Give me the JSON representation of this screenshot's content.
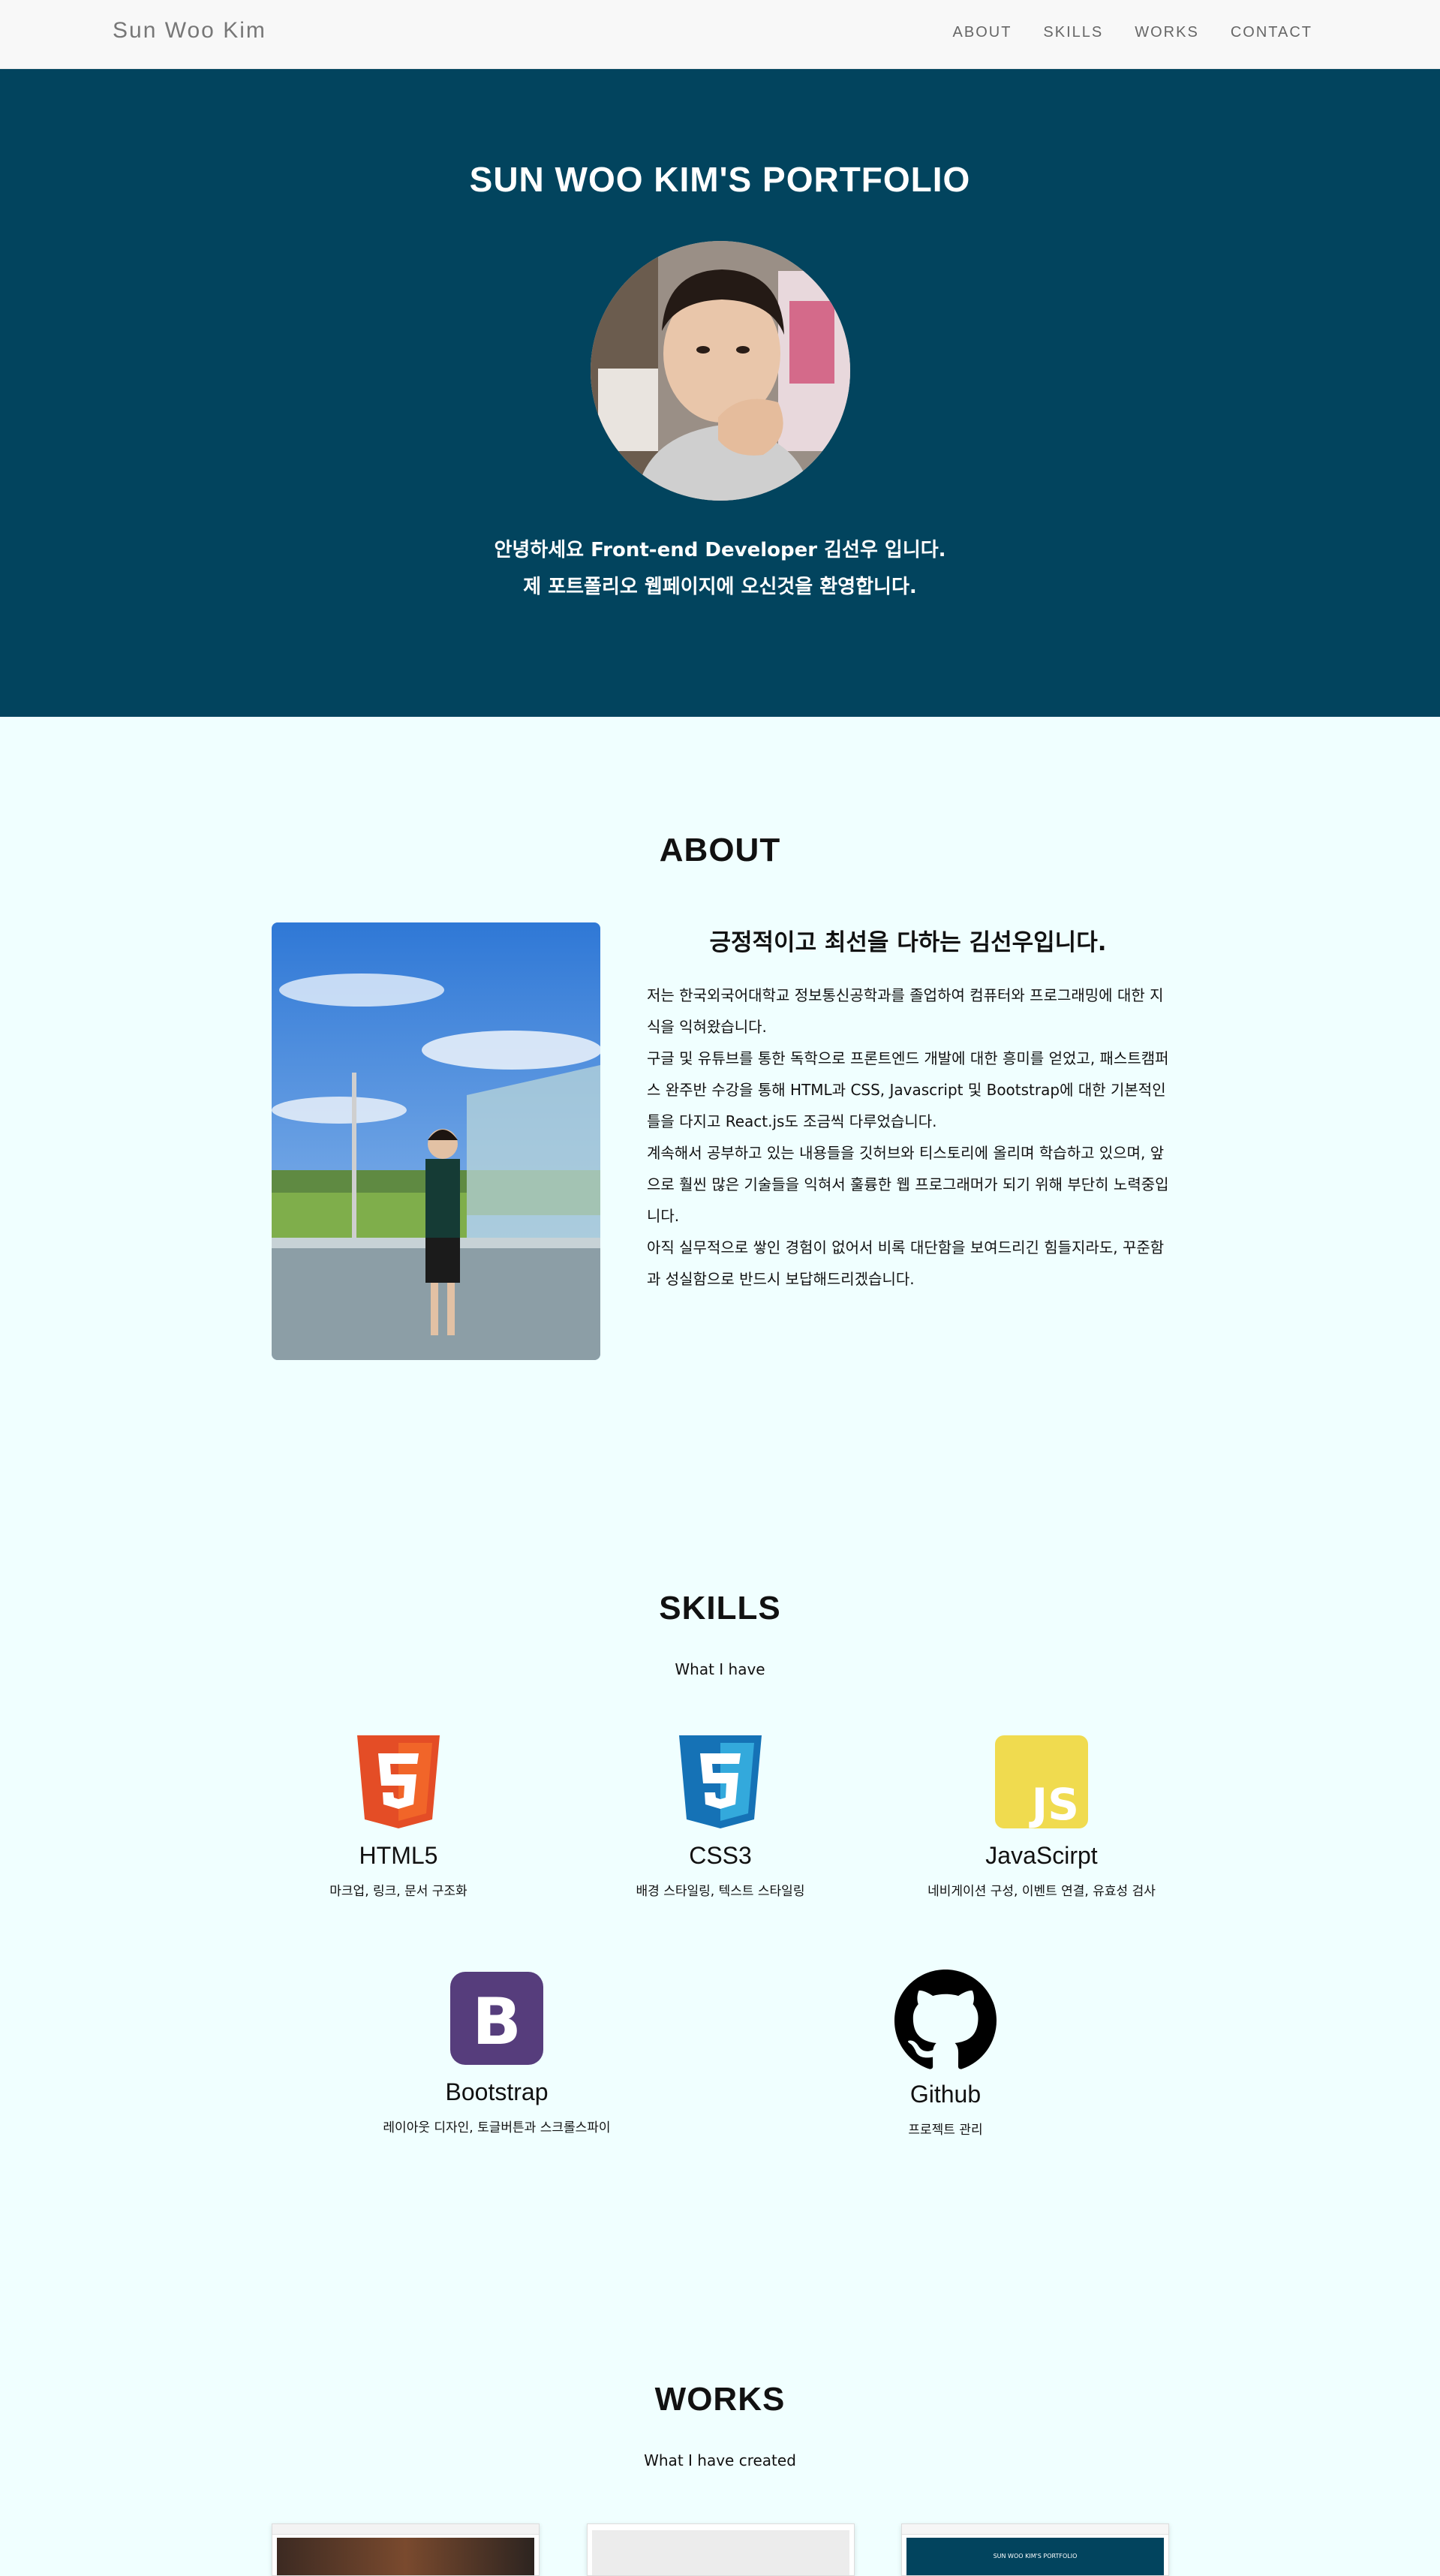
{
  "nav": {
    "brand": "Sun Woo Kim",
    "links": [
      {
        "label": "ABOUT"
      },
      {
        "label": "SKILLS"
      },
      {
        "label": "WORKS"
      },
      {
        "label": "CONTACT"
      }
    ]
  },
  "hero": {
    "title": "SUN WOO KIM'S PORTFOLIO",
    "greeting_line1": "안녕하세요 Front-end Developer 김선우 입니다.",
    "greeting_line2": "제 포트폴리오 웹페이지에 오신것을 환영합니다.",
    "background_color": "#02445e"
  },
  "about": {
    "title": "ABOUT",
    "heading": "긍정적이고 최선을 다하는 김선우입니다.",
    "paragraphs": [
      "저는 한국외국어대학교 정보통신공학과를 졸업하여 컴퓨터와 프로그래밍에 대한 지식을 익혀왔습니다.",
      "구글 및 유튜브를 통한 독학으로 프론트엔드 개발에 대한 흥미를 얻었고, 패스트캠퍼스 완주반 수강을 통해 HTML과 CSS, Javascript 및 Bootstrap에 대한 기본적인 틀을 다지고 React.js도 조금씩 다루었습니다.",
      "계속해서 공부하고 있는 내용들을 깃허브와 티스토리에 올리며 학습하고 있으며, 앞으로 훨씬 많은 기술들을 익혀서 훌륭한 웹 프로그래머가 되기 위해 부단히 노력중입니다.",
      "아직 실무적으로 쌓인 경험이 없어서 비록 대단함을 보여드리긴 힘들지라도, 꾸준함과 성실함으로 반드시 보답해드리겠습니다."
    ]
  },
  "skills": {
    "title": "SKILLS",
    "subtitle": "What I have",
    "items": [
      {
        "name": "HTML5",
        "desc": "마크업, 링크, 문서 구조화",
        "icon": "html5-icon",
        "color": "#e44d26"
      },
      {
        "name": "CSS3",
        "desc": "배경 스타일링, 텍스트 스타일링",
        "icon": "css3-icon",
        "color": "#1572b6"
      },
      {
        "name": "JavaScirpt",
        "desc": "네비게이션 구성, 이벤트 연결, 유효성 검사",
        "icon": "javascript-icon",
        "color": "#f0db4f"
      },
      {
        "name": "Bootstrap",
        "desc": "레이아웃 디자인, 토글버튼과 스크롤스파이",
        "icon": "bootstrap-icon",
        "color": "#563d7c"
      },
      {
        "name": "Github",
        "desc": "프로젝트 관리",
        "icon": "github-icon",
        "color": "#000000"
      }
    ]
  },
  "works": {
    "title": "WORKS",
    "subtitle": "What I have created",
    "cards": [
      {
        "thumb_text": ""
      },
      {
        "thumb_text": ""
      },
      {
        "thumb_text": "SUN WOO KIM'S PORTFOLIO"
      }
    ]
  }
}
